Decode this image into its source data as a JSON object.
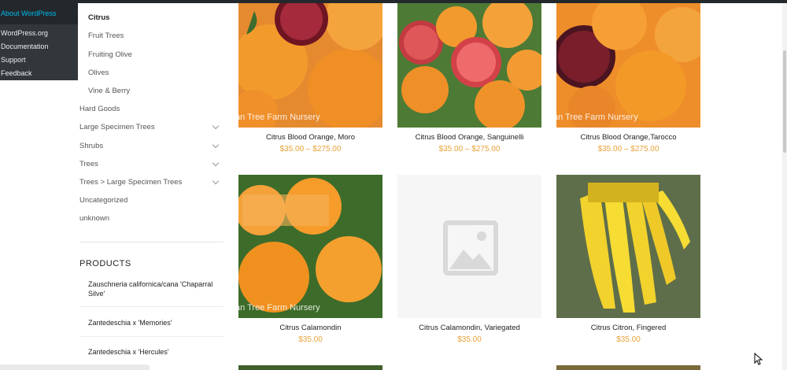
{
  "wp_menu": {
    "about": "About WordPress",
    "items": [
      "WordPress.org",
      "Documentation",
      "Support",
      "Feedback"
    ]
  },
  "categories": [
    {
      "label": "Citrus",
      "current": true
    },
    {
      "label": "Fruit Trees"
    },
    {
      "label": "Fruiting Olive"
    },
    {
      "label": "Olives"
    },
    {
      "label": "Vine & Berry"
    },
    {
      "label": "Hard Goods"
    },
    {
      "label": "Large Specimen Trees"
    },
    {
      "label": "Shrubs"
    },
    {
      "label": "Trees"
    },
    {
      "label": "Trees > Large Specimen Trees"
    },
    {
      "label": "Uncategorized"
    },
    {
      "label": "unknown"
    }
  ],
  "products_widget": {
    "title": "PRODUCTS",
    "items": [
      "Zauschneria californica/cana 'Chaparral Silve'",
      "Zantedeschia x 'Memories'",
      "Zantedeschia x 'Hercules'"
    ]
  },
  "products": [
    {
      "name": "Citrus Blood Orange, Moro",
      "price": "$35.00 – $275.00",
      "watermark": "an Tree Farm Nursery"
    },
    {
      "name": "Citrus Blood Orange, Sanguinelli",
      "price": "$35.00 – $275.00"
    },
    {
      "name": "Citrus Blood Orange,Tarocco",
      "price": "$35.00 – $275.00",
      "watermark": "an Tree Farm Nursery"
    },
    {
      "name": "Citrus Calamondin",
      "price": "$35.00",
      "watermark": "an Tree Farm Nursery"
    },
    {
      "name": "Citrus Calamondin, Variegated",
      "price": "$35.00"
    },
    {
      "name": "Citrus Citron, Fingered",
      "price": "$35.00"
    }
  ],
  "colors": {
    "price": "#e8a33a",
    "admin_bar": "#23282d",
    "admin_link": "#00b9eb"
  }
}
